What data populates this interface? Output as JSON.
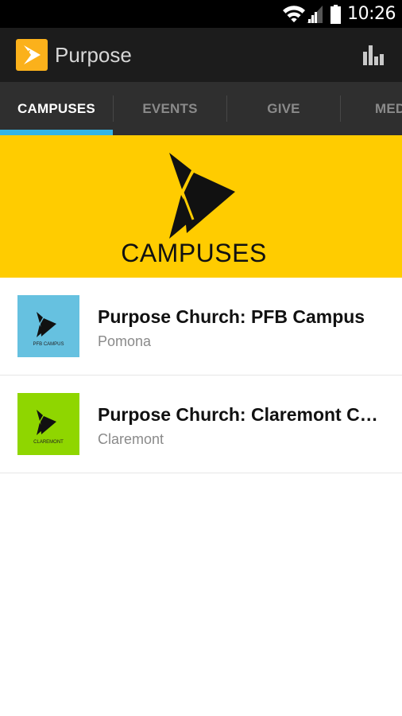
{
  "status_bar": {
    "time": "10:26",
    "icons": [
      "wifi-icon",
      "cell-signal-icon",
      "battery-icon"
    ]
  },
  "action_bar": {
    "app_icon": "purpose-app-icon",
    "title": "Purpose",
    "action_icon": "bar-chart-icon"
  },
  "tabs": [
    {
      "label": "CAMPUSES",
      "active": true
    },
    {
      "label": "EVENTS",
      "active": false
    },
    {
      "label": "GIVE",
      "active": false
    },
    {
      "label": "MEDIA",
      "active": false
    }
  ],
  "hero": {
    "title": "CAMPUSES",
    "logo_icon": "purpose-arrow-logo"
  },
  "campuses": [
    {
      "title": "Purpose Church: PFB Campus",
      "subtitle": "Pomona",
      "thumb_caption": "PFB CAMPUS",
      "thumb_color": "#66c1e0"
    },
    {
      "title": "Purpose Church: Claremont Campus",
      "subtitle": "Claremont",
      "thumb_caption": "CLAREMONT",
      "thumb_color": "#8fd600"
    }
  ],
  "colors": {
    "accent_indicator": "#33b5e5",
    "hero_background": "#ffcc00",
    "app_icon_background": "#fbb11b"
  }
}
